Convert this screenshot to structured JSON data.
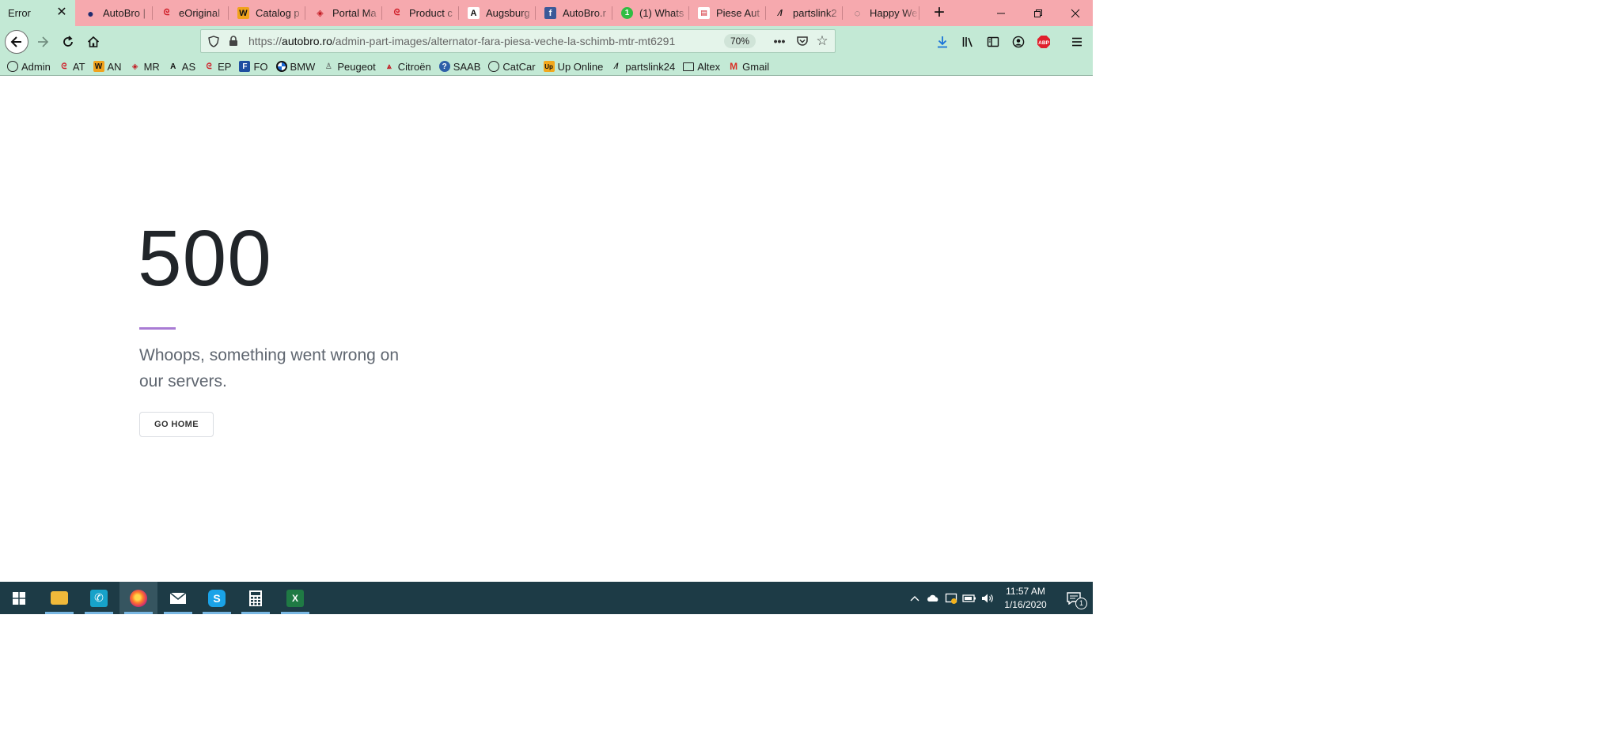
{
  "tabs": [
    {
      "title": "Error",
      "favicon": "none",
      "active": true
    },
    {
      "title": "AutoBro |",
      "favicon": "autobro-icon"
    },
    {
      "title": "eOriginal",
      "favicon": "eoriginal-icon"
    },
    {
      "title": "Catalog p",
      "favicon": "catalog-icon"
    },
    {
      "title": "Portal Ma",
      "favicon": "portal-icon"
    },
    {
      "title": "Product c",
      "favicon": "product-icon"
    },
    {
      "title": "Augsburg",
      "favicon": "augsburg-icon"
    },
    {
      "title": "AutoBro.r",
      "favicon": "facebook-icon"
    },
    {
      "title": "(1) Whats",
      "favicon": "whatsapp-icon"
    },
    {
      "title": "Piese Aut",
      "favicon": "piese-icon"
    },
    {
      "title": "partslink2",
      "favicon": "partslink-icon"
    },
    {
      "title": "Happy We",
      "favicon": "happy-icon"
    }
  ],
  "address": {
    "prefix": "https://",
    "host": "autobro.ro",
    "path": "/admin-part-images/alternator-fara-piesa-veche-la-schimb-mtr-mt6291",
    "zoom": "70%"
  },
  "bookmarks": [
    {
      "label": "Admin",
      "icon": "globe-icon"
    },
    {
      "label": "AT",
      "icon": "at-icon"
    },
    {
      "label": "AN",
      "icon": "an-icon"
    },
    {
      "label": "MR",
      "icon": "mr-icon"
    },
    {
      "label": "AS",
      "icon": "as-icon"
    },
    {
      "label": "EP",
      "icon": "ep-icon"
    },
    {
      "label": "FO",
      "icon": "fo-icon"
    },
    {
      "label": "BMW",
      "icon": "bmw-icon"
    },
    {
      "label": "Peugeot",
      "icon": "peugeot-icon"
    },
    {
      "label": "Citroën",
      "icon": "citroen-icon"
    },
    {
      "label": "SAAB",
      "icon": "saab-icon"
    },
    {
      "label": "CatCar",
      "icon": "globe-icon"
    },
    {
      "label": "Up Online",
      "icon": "up-icon"
    },
    {
      "label": "partslink24",
      "icon": "partslink-icon"
    },
    {
      "label": "Altex",
      "icon": "folder-icon"
    },
    {
      "label": "Gmail",
      "icon": "gmail-icon"
    }
  ],
  "error": {
    "code": "500",
    "message": "Whoops, something went wrong on our servers.",
    "button": "GO HOME"
  },
  "taskbar": {
    "time": "11:57 AM",
    "date": "1/16/2020",
    "notifications": "1"
  },
  "colors": {
    "tab_strip": "#f6a9ae",
    "toolbar": "#c3e9d5",
    "accent_line": "#a97bd4",
    "taskbar": "#1d3b46"
  }
}
